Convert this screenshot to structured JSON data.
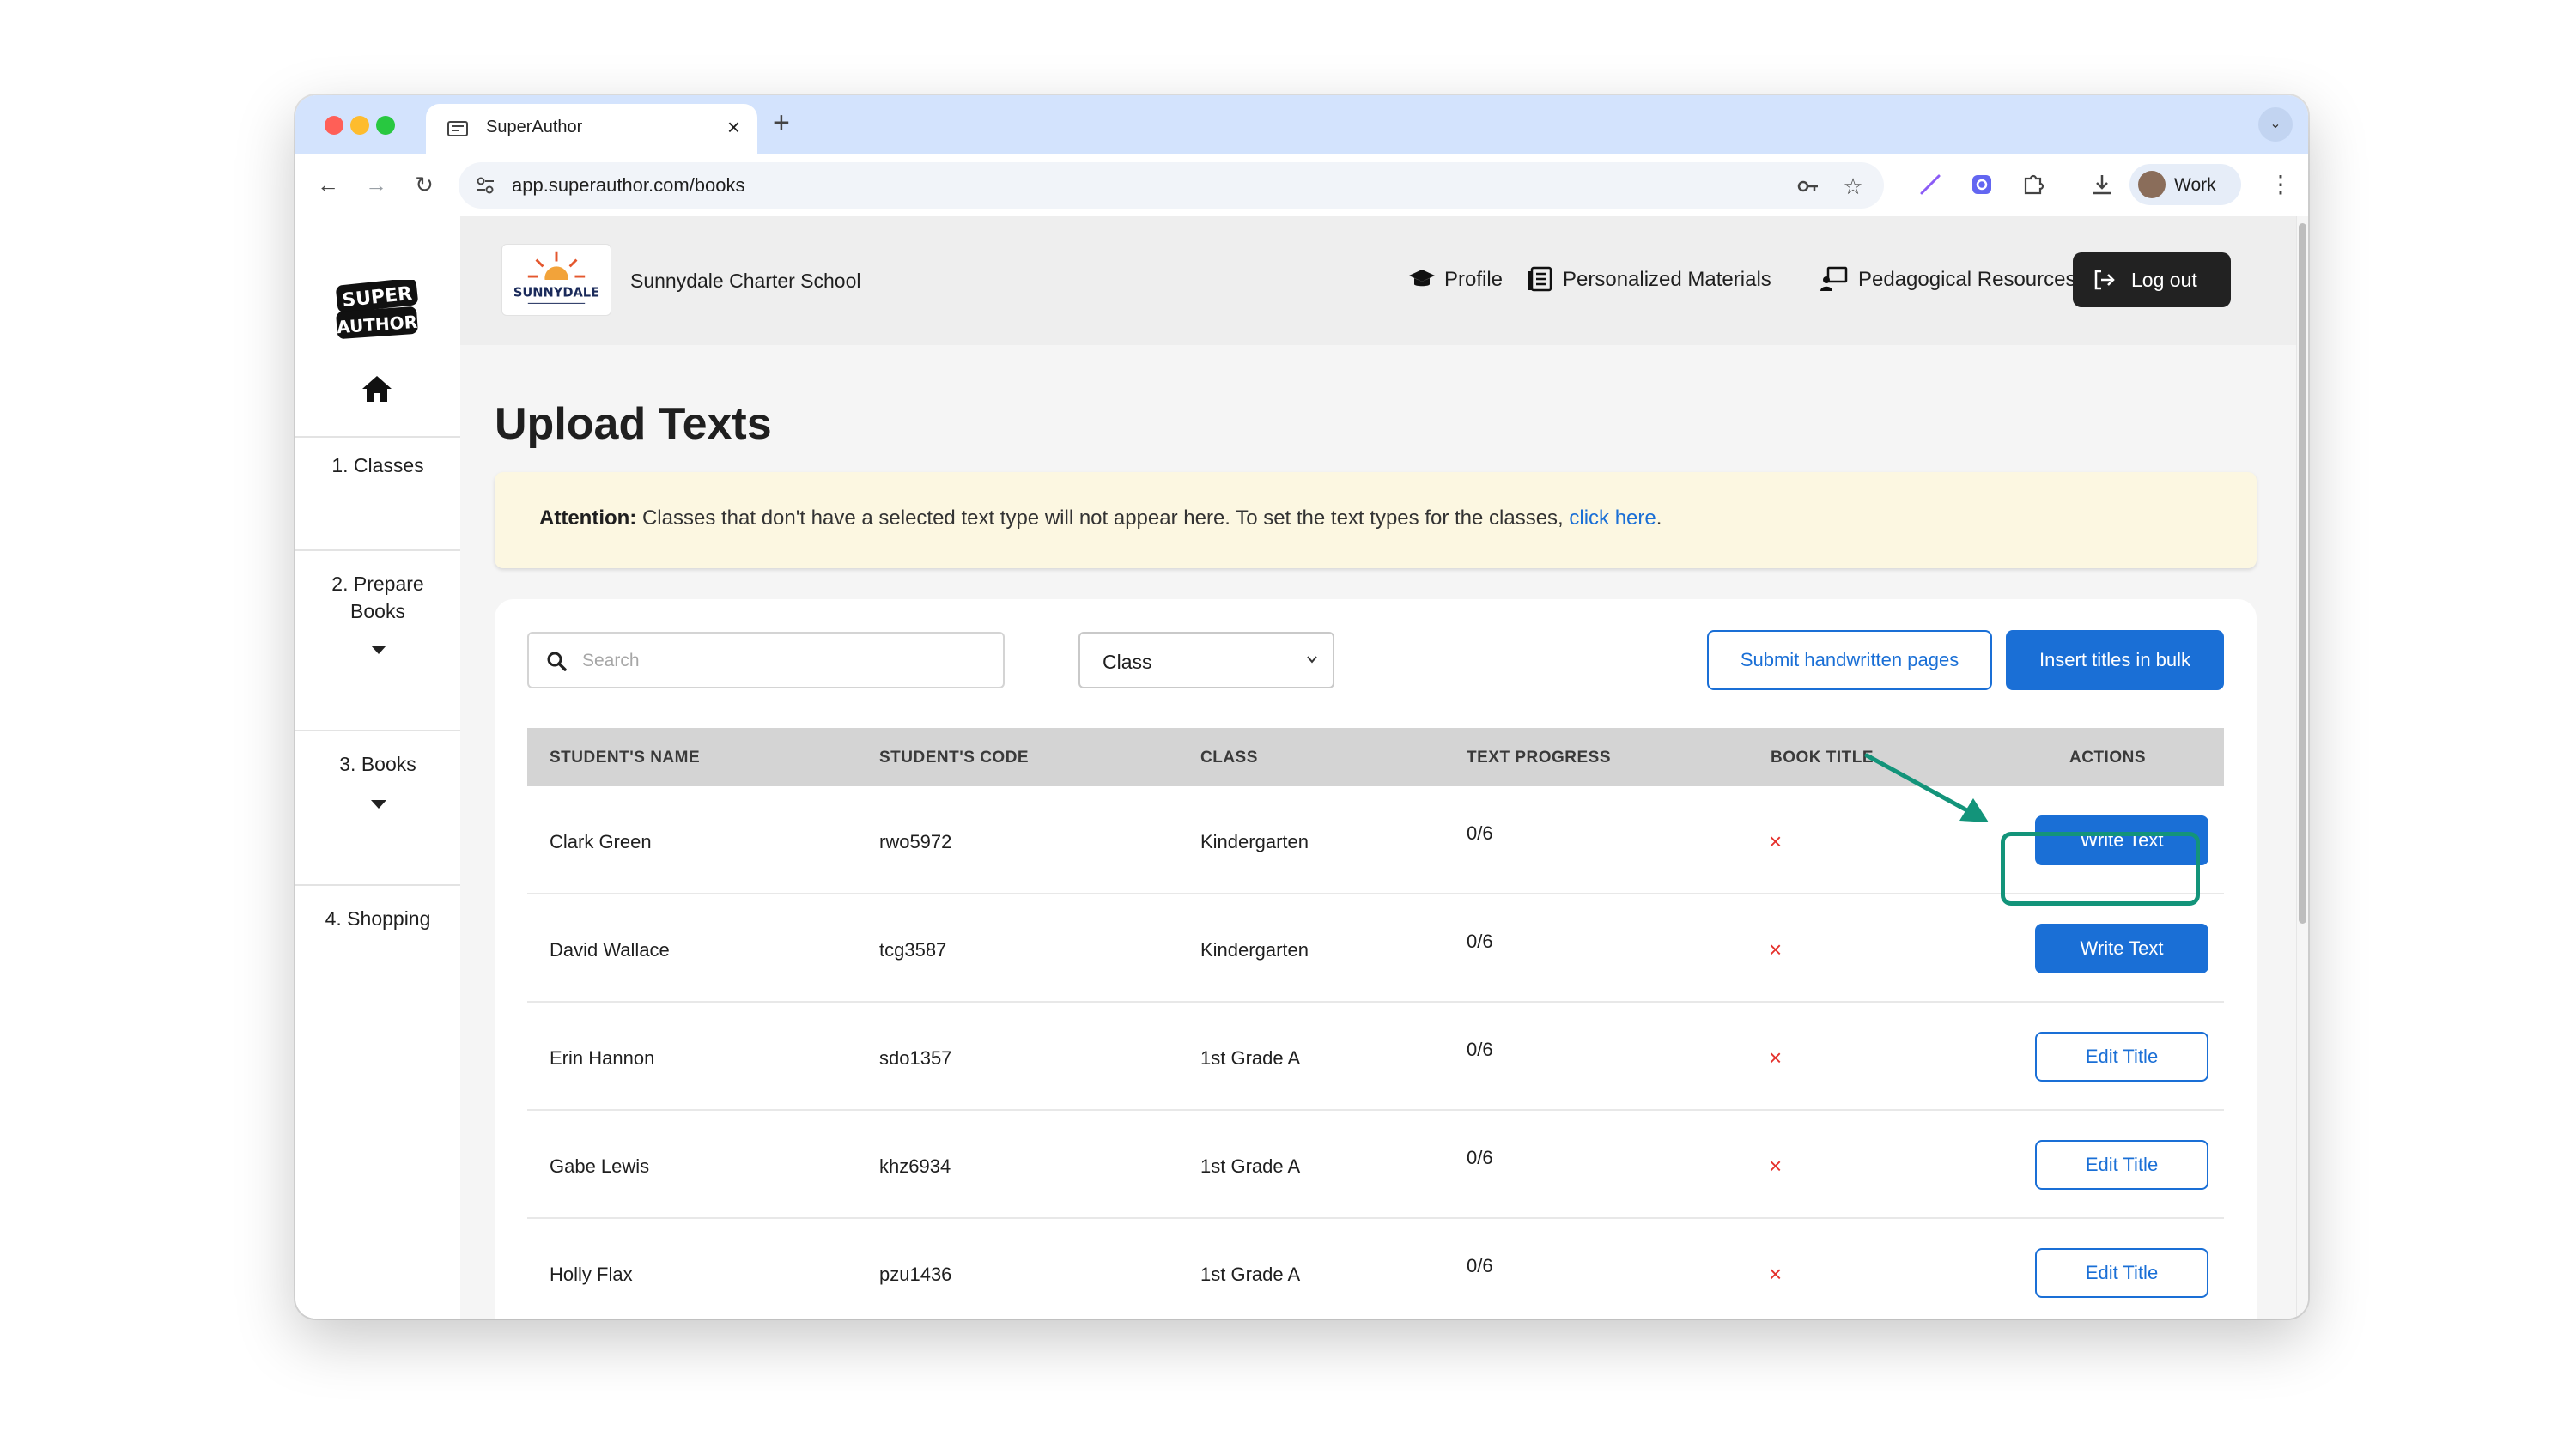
{
  "browser": {
    "tab_title": "SuperAuthor",
    "url": "app.superauthor.com/books",
    "profile_label": "Work",
    "new_tab_symbol": "+",
    "close_symbol": "×"
  },
  "sidebar": {
    "logo_text": "SUPER AUTHOR",
    "items": [
      {
        "label": "1. Classes"
      },
      {
        "label": "2. Prepare Books"
      },
      {
        "label": "3. Books"
      },
      {
        "label": "4. Shopping"
      }
    ]
  },
  "header": {
    "school_logo_text": "SUNNYDALE",
    "school_name": "Sunnydale Charter School",
    "nav": [
      {
        "label": "Profile",
        "icon": "graduation-cap-icon"
      },
      {
        "label": "Personalized Materials",
        "icon": "book-icon"
      },
      {
        "label": "Pedagogical Resources",
        "icon": "teacher-board-icon"
      }
    ],
    "logout_label": "Log out"
  },
  "main": {
    "title": "Upload Texts",
    "alert": {
      "bold": "Attention:",
      "text": "Classes that don't have a selected text type will not appear here. To set the text types for the classes,",
      "link": "click here",
      "end": "."
    },
    "search_placeholder": "Search",
    "class_select_value": "Class",
    "submit_button": "Submit handwritten pages",
    "insert_button": "Insert titles in bulk",
    "columns": [
      "STUDENT'S NAME",
      "STUDENT'S CODE",
      "CLASS",
      "TEXT PROGRESS",
      "BOOK TITLE",
      "ACTIONS"
    ],
    "rows": [
      {
        "name": "Clark Green",
        "code": "rwo5972",
        "class": "Kindergarten",
        "progress": "0/6",
        "book_title": "×",
        "action": "Write Text"
      },
      {
        "name": "David Wallace",
        "code": "tcg3587",
        "class": "Kindergarten",
        "progress": "0/6",
        "book_title": "×",
        "action": "Write Text"
      },
      {
        "name": "Erin Hannon",
        "code": "sdo1357",
        "class": "1st Grade A",
        "progress": "0/6",
        "book_title": "×",
        "action": "Edit Title"
      },
      {
        "name": "Gabe Lewis",
        "code": "khz6934",
        "class": "1st Grade A",
        "progress": "0/6",
        "book_title": "×",
        "action": "Edit Title"
      },
      {
        "name": "Holly Flax",
        "code": "pzu1436",
        "class": "1st Grade A",
        "progress": "0/6",
        "book_title": "×",
        "action": "Edit Title"
      }
    ]
  },
  "colors": {
    "accent": "#1a6fd6",
    "annotation": "#13947a",
    "alert_bg": "#fcf7e1",
    "x_mark": "#e5322d"
  }
}
